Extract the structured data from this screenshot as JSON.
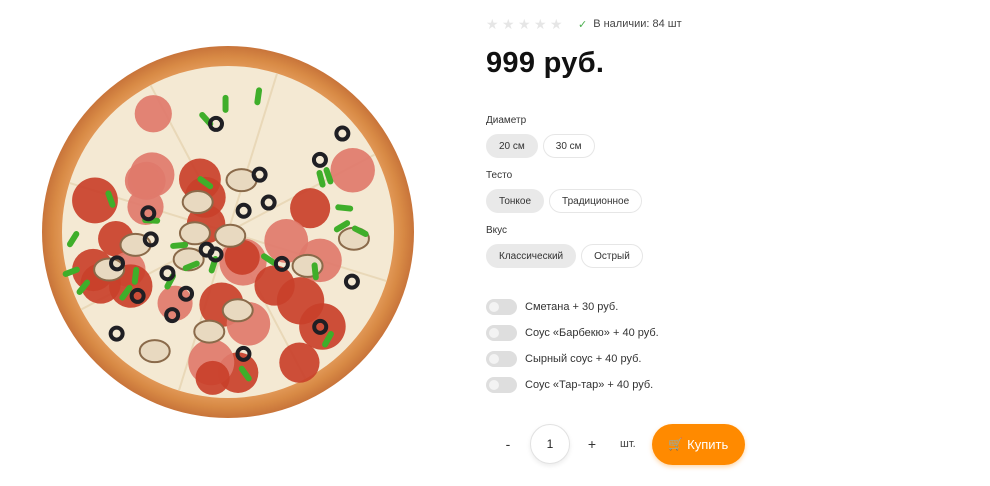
{
  "product": {
    "rating_stars": 5,
    "rating_filled": 0,
    "stock_text": "В наличии: 84 шт",
    "price": "999 руб."
  },
  "options": {
    "diameter": {
      "label": "Диаметр",
      "choices": [
        "20 см",
        "30 см"
      ],
      "selected": "20 см"
    },
    "dough": {
      "label": "Тесто",
      "choices": [
        "Тонкое",
        "Традиционное"
      ],
      "selected": "Тонкое"
    },
    "taste": {
      "label": "Вкус",
      "choices": [
        "Классический",
        "Острый"
      ],
      "selected": "Классический"
    }
  },
  "addons": [
    {
      "label": "Сметана + 30 руб.",
      "enabled": false
    },
    {
      "label": "Соус «Барбекю» + 40 руб.",
      "enabled": false
    },
    {
      "label": "Сырный соус + 40 руб.",
      "enabled": false
    },
    {
      "label": "Соус «Тар-тар» + 40 руб.",
      "enabled": false
    }
  ],
  "purchase": {
    "minus": "-",
    "quantity": "1",
    "plus": "+",
    "unit": "шт.",
    "buy_label": "Купить"
  },
  "icons": {
    "star": "star-icon",
    "check": "check-icon",
    "cart": "cart-icon"
  },
  "colors": {
    "accent": "#ff8a00",
    "stock_check": "#4caf50",
    "chip_active": "#e9e9e9"
  }
}
